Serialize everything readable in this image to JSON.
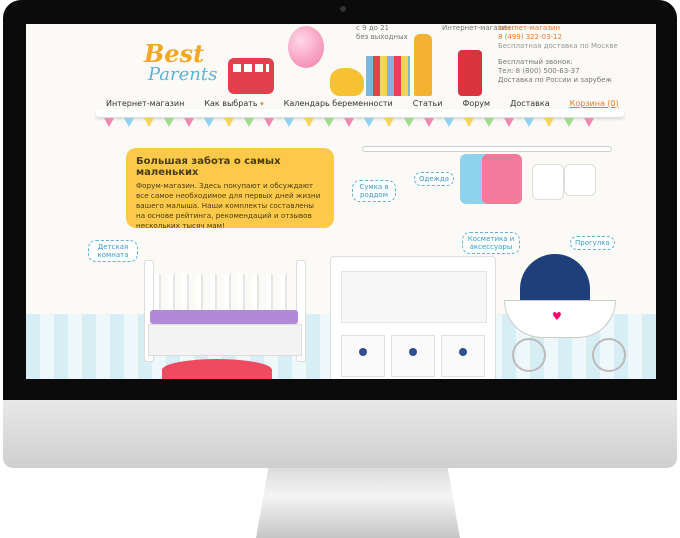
{
  "site": {
    "logo": {
      "line1": "Best",
      "line2": "Parents"
    },
    "header_contacts": {
      "left": [
        "с 9 до 21",
        "без выходных"
      ],
      "right_top": [
        "Interneт-магазин",
        "Интернет-магазин",
        "8 (499) 322-03-12",
        "Бесплатная доставка по Москве"
      ],
      "right_bottom": [
        "Бесплатный звонок:",
        "Тел: 8 (800) 500-63-37",
        "Доставка по России и зарубеж"
      ]
    },
    "nav": {
      "items": [
        "Интернет-магазин",
        "Как выбрать",
        "Календарь беременности",
        "Статьи",
        "Форум",
        "Доставка"
      ],
      "cart": "Корзина (0)"
    },
    "promo": {
      "title": "Большая забота о самых маленьких",
      "body": "Форум-магазин. Здесь покупают и обсуждают все самое необходимое для первых дней жизни вашего малыша. Наши комплекты составлены на основе рейтинга, рекомендаций и отзывов нескольких тысяч мам!"
    },
    "tags": {
      "bag": "Сумка в роддом",
      "clothes": "Одежда",
      "room": "Детская комната",
      "cosmetics": "Косметика и аксессуары",
      "stroller": "Прогулка"
    }
  },
  "colors": {
    "accent": "#e47a2c",
    "promo_bg": "#fcc94a",
    "tag_blue": "#3d9bc9"
  },
  "icons": {
    "apple_logo": "apple-logo-icon"
  }
}
